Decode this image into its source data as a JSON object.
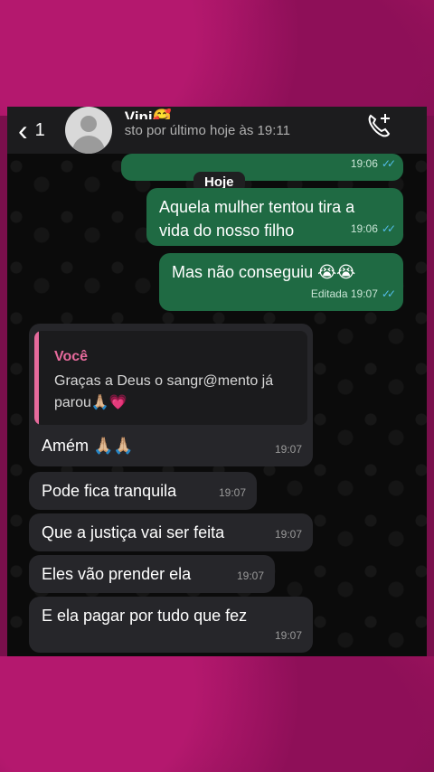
{
  "header": {
    "back_icon": "chevron-left-icon",
    "back_count": "1",
    "contact_name": "Vini🥰",
    "contact_status": "sto por último hoje às 19:11",
    "call_icon": "phone-add-icon"
  },
  "chat": {
    "date_chip": "Hoje",
    "messages": [
      {
        "dir": "out",
        "text": "",
        "time": "19:06",
        "ticks": "✓✓"
      },
      {
        "dir": "out",
        "text": "Aquela mulher tentou tira a vida do nosso filho",
        "time": "19:06",
        "ticks": "✓✓"
      },
      {
        "dir": "out",
        "text": "Mas não conseguiu 😭😭",
        "time": "Editada 19:07",
        "ticks": "✓✓"
      },
      {
        "dir": "in",
        "quote_author": "Você",
        "quote_text": "Graças a Deus o sangr@mento já parou🙏🏼💗",
        "text": "Amém 🙏🏼🙏🏼",
        "time": "19:07"
      },
      {
        "dir": "in",
        "text": "Pode fica tranquila",
        "time": "19:07"
      },
      {
        "dir": "in",
        "text": "Que a justiça vai ser feita",
        "time": "19:07"
      },
      {
        "dir": "in",
        "text": "Eles vão prender ela",
        "time": "19:07"
      },
      {
        "dir": "in",
        "text": "E ela pagar por tudo que fez",
        "time": "19:07"
      }
    ]
  },
  "colors": {
    "outgoing": "#1f6a43",
    "incoming": "#26262a",
    "quote_accent": "#e66a9c",
    "frame": "#9b1460"
  }
}
